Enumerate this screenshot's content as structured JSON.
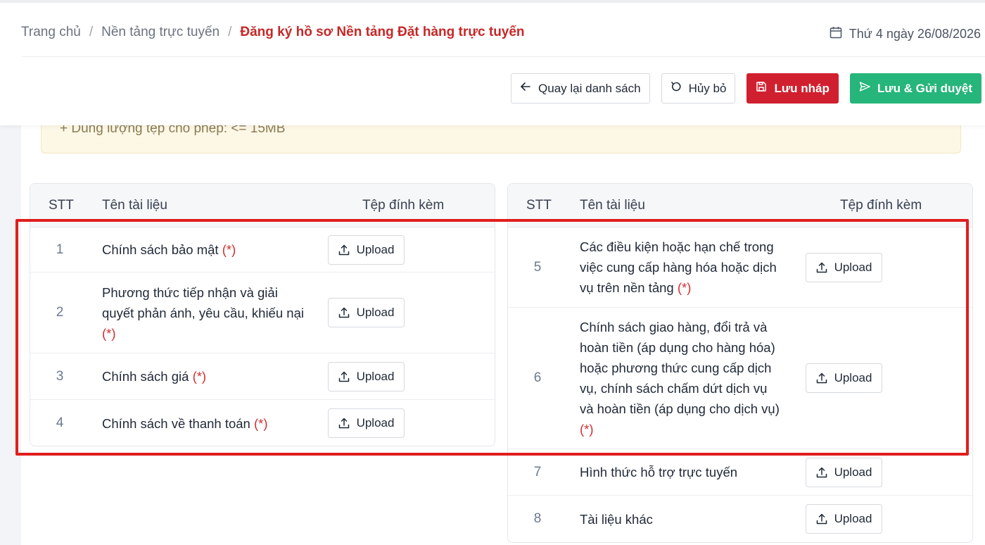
{
  "breadcrumb": {
    "home": "Trang chủ",
    "separator": "/",
    "section": "Nền tảng trực tuyến",
    "current": "Đăng ký hồ sơ Nền tảng Đặt hàng trực tuyến"
  },
  "date_label": "Thứ 4 ngày 26/08/2026",
  "actions": {
    "back": "Quay lại danh sách",
    "cancel": "Hủy bỏ",
    "save_draft": "Lưu nháp",
    "save_submit": "Lưu & Gửi duyệt"
  },
  "notice_text": "+ Dung lượng tệp cho phép: <= 15MB",
  "table_headers": {
    "stt": "STT",
    "name": "Tên tài liệu",
    "attachment": "Tệp đính kèm"
  },
  "upload_label": "Upload",
  "required_mark": "(*)",
  "left_docs": [
    {
      "stt": "1",
      "name": "Chính sách bảo mật",
      "required": true
    },
    {
      "stt": "2",
      "name": "Phương thức tiếp nhận và giải quyết phản ánh, yêu cầu, khiếu nại",
      "required": true
    },
    {
      "stt": "3",
      "name": "Chính sách giá",
      "required": true
    },
    {
      "stt": "4",
      "name": "Chính sách về thanh toán",
      "required": true
    }
  ],
  "right_docs": [
    {
      "stt": "5",
      "name": "Các điều kiện hoặc hạn chế trong việc cung cấp hàng hóa hoặc dịch vụ trên nền tảng",
      "required": true
    },
    {
      "stt": "6",
      "name": "Chính sách giao hàng, đổi trả và hoàn tiền (áp dụng cho hàng hóa) hoặc phương thức cung cấp dịch vụ, chính sách chấm dứt dịch vụ và hoàn tiền (áp dụng cho dịch vụ)",
      "required": true
    },
    {
      "stt": "7",
      "name": "Hình thức hỗ trợ trực tuyến",
      "required": false
    },
    {
      "stt": "8",
      "name": "Tài liệu khác",
      "required": false
    }
  ],
  "colors": {
    "highlight": "#e01e1e",
    "danger": "#d0202f",
    "success": "#26b57a",
    "required": "#d32f2f",
    "breadcrumb_current": "#c62828"
  }
}
